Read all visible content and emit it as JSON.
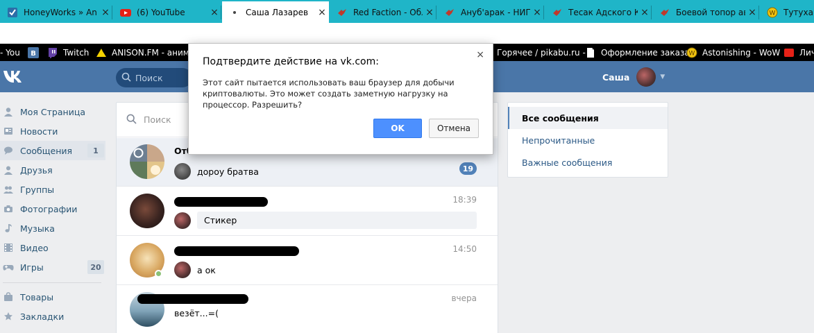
{
  "browser": {
    "tabs": [
      {
        "title": "HoneyWorks » An",
        "icon": "honeyworks-favicon",
        "close": "×"
      },
      {
        "title": "(6) YouTube",
        "icon": "youtube-icon",
        "close": "×"
      },
      {
        "title": "Саша Лазарев",
        "icon": "vk-loading-icon",
        "close": "×"
      },
      {
        "title": "Red Faction - Обл",
        "icon": "wiki-bird-icon",
        "close": "×"
      },
      {
        "title": "Ануб'арак - НИП",
        "icon": "wiki-bird-icon",
        "close": "×"
      },
      {
        "title": "Тесак Адского Кр",
        "icon": "wiki-bird-icon",
        "close": "×"
      },
      {
        "title": "Боевой топор ав",
        "icon": "wiki-bird-icon",
        "close": "×"
      },
      {
        "title": "Тутухара",
        "icon": "wow-icon",
        "close": ""
      }
    ],
    "bookmarks": [
      {
        "label": "- You",
        "icon": ""
      },
      {
        "label": "",
        "icon": "vk-b-icon"
      },
      {
        "label": "Twitch",
        "icon": "twitch-icon"
      },
      {
        "label": "ANISON.FM - аниме",
        "icon": "anison-icon"
      },
      {
        "label": "Горячее / pikabu.ru -",
        "icon": ""
      },
      {
        "label": "Оформление заказа",
        "icon": "document-icon"
      },
      {
        "label": "Astonishing - WoW",
        "icon": "wow-icon"
      },
      {
        "label": "Лич",
        "icon": "red-icon"
      }
    ],
    "colors": {
      "tabstrip": "#1fb5c8",
      "bookmarks_bar": "#000000"
    }
  },
  "vk": {
    "header": {
      "search_placeholder": "Поиск",
      "user_name": "Саша"
    },
    "menu": [
      {
        "label": "Моя Страница",
        "icon": "user-icon",
        "badge": ""
      },
      {
        "label": "Новости",
        "icon": "news-icon",
        "badge": ""
      },
      {
        "label": "Сообщения",
        "icon": "chat-icon",
        "badge": "1"
      },
      {
        "label": "Друзья",
        "icon": "friend-icon",
        "badge": ""
      },
      {
        "label": "Группы",
        "icon": "group-icon",
        "badge": ""
      },
      {
        "label": "Фотографии",
        "icon": "camera-icon",
        "badge": ""
      },
      {
        "label": "Музыка",
        "icon": "music-icon",
        "badge": ""
      },
      {
        "label": "Видео",
        "icon": "film-icon",
        "badge": ""
      },
      {
        "label": "Игры",
        "icon": "gamepad-icon",
        "badge": "20"
      },
      {
        "label": "Товары",
        "icon": "bag-icon",
        "badge": ""
      },
      {
        "label": "Закладки",
        "icon": "star-icon",
        "badge": ""
      }
    ],
    "messages": {
      "search_placeholder": "Поиск",
      "conversations": [
        {
          "name": "Отб",
          "time": "",
          "snippet": "дороу братва",
          "unread": "19"
        },
        {
          "name": "",
          "time": "18:39",
          "snippet": "Стикер",
          "unread": ""
        },
        {
          "name": "",
          "time": "14:50",
          "snippet": "а ок",
          "unread": ""
        },
        {
          "name": "",
          "time": "вчера",
          "snippet": "везёт...=(",
          "unread": ""
        }
      ]
    },
    "filters": [
      {
        "label": "Все сообщения",
        "active": true
      },
      {
        "label": "Непрочитанные",
        "active": false
      },
      {
        "label": "Важные сообщения",
        "active": false
      }
    ],
    "colors": {
      "header": "#4a76a8",
      "link": "#2a5885",
      "badge": "#5181b8"
    }
  },
  "dialog": {
    "title": "Подтвердите действие на vk.com:",
    "message": "Этот сайт пытается использовать ваш браузер для добычи криптовалюты. Это может создать заметную нагрузку на процессор. Разрешить?",
    "ok_label": "OK",
    "cancel_label": "Отмена",
    "close": "×"
  }
}
